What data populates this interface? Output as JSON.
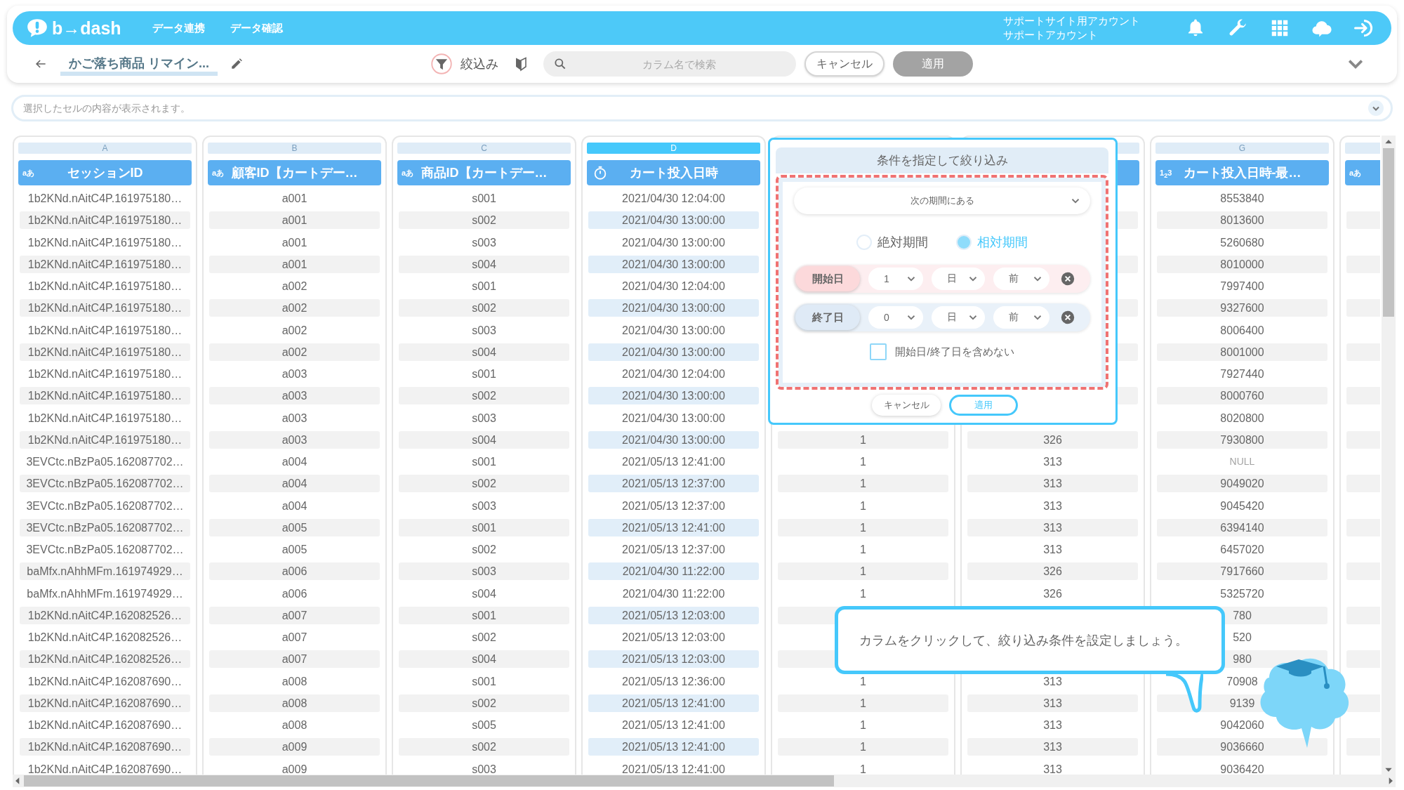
{
  "header": {
    "logo": "b→dash",
    "nav": [
      {
        "label": "データ連携"
      },
      {
        "label": "データ確認"
      }
    ],
    "account": [
      "サポートサイト用アカウント",
      "サポートアカウント"
    ]
  },
  "toolbar": {
    "title": "かご落ち商品 リマイン...",
    "filter_label": "絞込み",
    "search": {
      "placeholder": "カラム名で検索"
    },
    "cancel": {
      "label": "キャンセル"
    },
    "apply": {
      "label": "適用",
      "disabled": true
    }
  },
  "cell_bar": {
    "placeholder": "選択したセルの内容が表示されます。"
  },
  "columns": [
    {
      "letter": "A",
      "kind": "text",
      "type_label": "aあ",
      "title": "セッションID",
      "selected": false
    },
    {
      "letter": "B",
      "kind": "text",
      "type_label": "aあ",
      "title": "顧客ID【カートデー…",
      "selected": false
    },
    {
      "letter": "C",
      "kind": "text",
      "type_label": "aあ",
      "title": "商品ID【カートデー…",
      "selected": false
    },
    {
      "letter": "D",
      "kind": "datetime",
      "title": "カート投入日時",
      "selected": true
    },
    {
      "kind": "blank"
    },
    {
      "kind": "blank",
      "selected": false
    },
    {
      "letter": "G",
      "kind": "number",
      "type_label": "1$_{2}$3",
      "title": "カート投入日時-最…",
      "selected": false
    },
    {
      "kind": "text",
      "type_label": "aあ",
      "selected": false
    }
  ],
  "rows": [
    [
      "1b2KNd.nAitC4P.161975180…",
      "a001",
      "s001",
      "2021/04/30 12:04:00",
      null,
      null,
      "8553840"
    ],
    [
      "1b2KNd.nAitC4P.161975180…",
      "a001",
      "s002",
      "2021/04/30 13:00:00",
      null,
      null,
      "8013600"
    ],
    [
      "1b2KNd.nAitC4P.161975180…",
      "a001",
      "s003",
      "2021/04/30 13:00:00",
      null,
      null,
      "5260680"
    ],
    [
      "1b2KNd.nAitC4P.161975180…",
      "a001",
      "s004",
      "2021/04/30 13:00:00",
      null,
      null,
      "8010000"
    ],
    [
      "1b2KNd.nAitC4P.161975180…",
      "a002",
      "s001",
      "2021/04/30 12:04:00",
      null,
      null,
      "7997400"
    ],
    [
      "1b2KNd.nAitC4P.161975180…",
      "a002",
      "s002",
      "2021/04/30 13:00:00",
      null,
      null,
      "9327600"
    ],
    [
      "1b2KNd.nAitC4P.161975180…",
      "a002",
      "s003",
      "2021/04/30 13:00:00",
      null,
      null,
      "8006400"
    ],
    [
      "1b2KNd.nAitC4P.161975180…",
      "a002",
      "s004",
      "2021/04/30 13:00:00",
      null,
      null,
      "8001000"
    ],
    [
      "1b2KNd.nAitC4P.161975180…",
      "a003",
      "s001",
      "2021/04/30 12:04:00",
      null,
      null,
      "7927440"
    ],
    [
      "1b2KNd.nAitC4P.161975180…",
      "a003",
      "s002",
      "2021/04/30 13:00:00",
      null,
      null,
      "8000760"
    ],
    [
      "1b2KNd.nAitC4P.161975180…",
      "a003",
      "s003",
      "2021/04/30 13:00:00",
      null,
      null,
      "8020800"
    ],
    [
      "1b2KNd.nAitC4P.161975180…",
      "a003",
      "s004",
      "2021/04/30 13:00:00",
      "1",
      "326",
      "7930800"
    ],
    [
      "3EVCtc.nBzPa05.162087702…",
      "a004",
      "s001",
      "2021/05/13 12:41:00",
      "1",
      "313",
      {
        "text": "NULL",
        "null": true
      }
    ],
    [
      "3EVCtc.nBzPa05.162087702…",
      "a004",
      "s002",
      "2021/05/13 12:37:00",
      "1",
      "313",
      "9049020"
    ],
    [
      "3EVCtc.nBzPa05.162087702…",
      "a004",
      "s003",
      "2021/05/13 12:37:00",
      "1",
      "313",
      "9045420"
    ],
    [
      "3EVCtc.nBzPa05.162087702…",
      "a005",
      "s001",
      "2021/05/13 12:41:00",
      "1",
      "313",
      "6394140"
    ],
    [
      "3EVCtc.nBzPa05.162087702…",
      "a005",
      "s002",
      "2021/05/13 12:37:00",
      "1",
      "313",
      "6457020"
    ],
    [
      "baMfx.nAhhMFm.161974929…",
      "a006",
      "s003",
      "2021/04/30 11:22:00",
      "1",
      "326",
      "7917660"
    ],
    [
      "baMfx.nAhhMFm.161974929…",
      "a006",
      "s004",
      "2021/04/30 11:22:00",
      "1",
      "326",
      "5325720"
    ],
    [
      "1b2KNd.nAitC4P.162082526…",
      "a007",
      "s001",
      "2021/05/13 12:03:00",
      null,
      null,
      "780"
    ],
    [
      "1b2KNd.nAitC4P.162082526…",
      "a007",
      "s002",
      "2021/05/13 12:03:00",
      null,
      null,
      "520"
    ],
    [
      "1b2KNd.nAitC4P.162082526…",
      "a007",
      "s004",
      "2021/05/13 12:03:00",
      null,
      null,
      "980"
    ],
    [
      "1b2KNd.nAitC4P.162087690…",
      "a008",
      "s001",
      "2021/05/13 12:36:00",
      "1",
      "313",
      "70908"
    ],
    [
      "1b2KNd.nAitC4P.162087690…",
      "a008",
      "s002",
      "2021/05/13 12:41:00",
      "1",
      "313",
      "9139"
    ],
    [
      "1b2KNd.nAitC4P.162087690…",
      "a008",
      "s005",
      "2021/05/13 12:41:00",
      "1",
      "313",
      "9042060"
    ],
    [
      "1b2KNd.nAitC4P.162087690…",
      "a009",
      "s002",
      "2021/05/13 12:41:00",
      "1",
      "313",
      "9036660"
    ],
    [
      "1b2KNd.nAitC4P.162087690…",
      "a009",
      "s003",
      "2021/05/13 12:41:00",
      "1",
      "313",
      "9036420"
    ]
  ],
  "filter_popup": {
    "title": "条件を指定して絞り込み",
    "condition": "次の期間にある",
    "modes": [
      {
        "label": "絶対期間",
        "selected": false
      },
      {
        "label": "相対期間",
        "selected": true
      }
    ],
    "ranges": [
      {
        "kind": "start",
        "label": "開始日",
        "amount": "1",
        "unit": "日",
        "direction": "前"
      },
      {
        "kind": "end",
        "label": "終了日",
        "amount": "0",
        "unit": "日",
        "direction": "前"
      }
    ],
    "exclude": {
      "label": "開始日/終了日を含めない",
      "checked": false
    },
    "cancel": "キャンセル",
    "apply": "適用"
  },
  "hint_bubble": {
    "text": "カラムをクリックして、絞り込み条件を設定しましょう。"
  }
}
